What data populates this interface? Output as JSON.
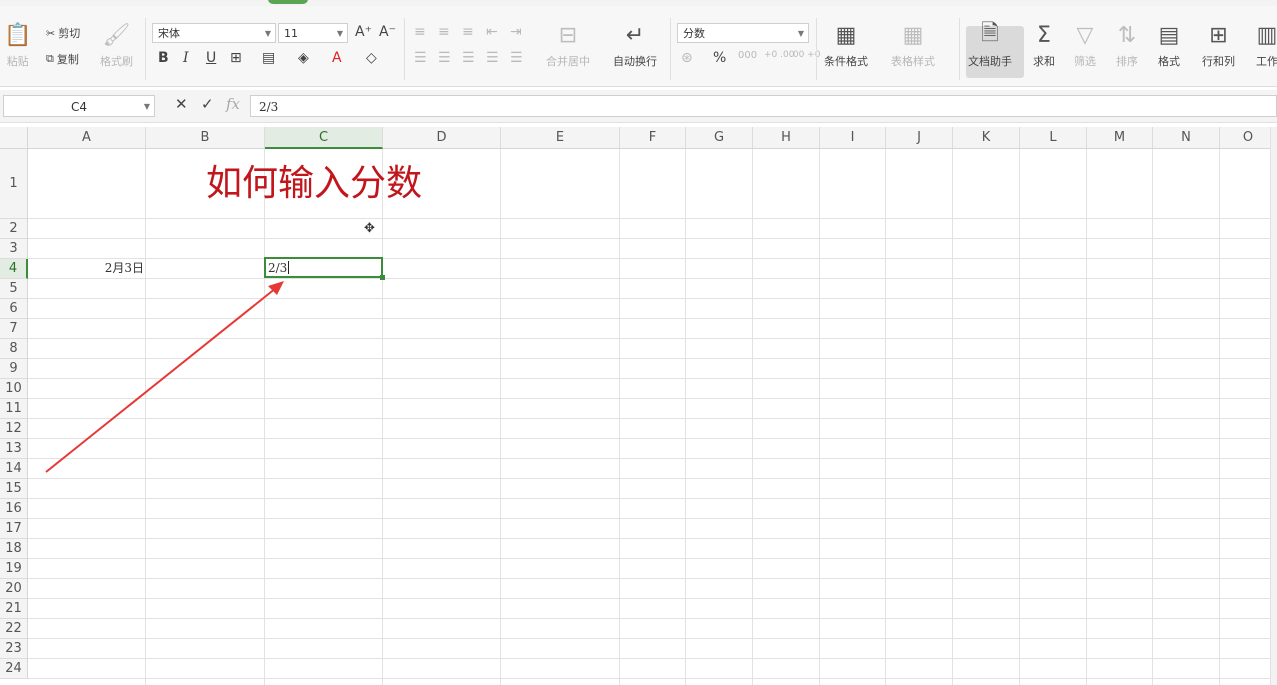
{
  "ribbon": {
    "paste": "粘贴",
    "cut": "剪切",
    "copy": "复制",
    "format_painter": "格式刷",
    "font_name": "宋体",
    "font_size": "11",
    "bold": "B",
    "italic": "I",
    "underline": "U",
    "merge_center": "合并居中",
    "wrap_text": "自动换行",
    "number_format": "分数",
    "percent": "%",
    "thousands": "000",
    "dec_increase": "+0 .00",
    "dec_decrease": ".00 +0",
    "conditional_format": "条件格式",
    "table_style": "表格样式",
    "doc_assistant": "文档助手",
    "sum": "求和",
    "filter": "筛选",
    "sort": "排序",
    "format": "格式",
    "row_col": "行和列",
    "worksheet": "工作"
  },
  "formula_bar": {
    "name_box": "C4",
    "fx": "fx",
    "value": "2/3"
  },
  "columns": [
    "A",
    "B",
    "C",
    "D",
    "E",
    "F",
    "G",
    "H",
    "I",
    "J",
    "K",
    "L",
    "M",
    "N",
    "O"
  ],
  "rows": [
    "1",
    "2",
    "3",
    "4",
    "5",
    "6",
    "7",
    "8",
    "9",
    "10",
    "11",
    "12",
    "13",
    "14",
    "15",
    "16",
    "17",
    "18",
    "19",
    "20",
    "21",
    "22",
    "23",
    "24"
  ],
  "cells": {
    "title": "如何输入分数",
    "a4": "2月3日",
    "c4": "2/3"
  },
  "selection": {
    "column": "C",
    "row": "4"
  },
  "colors": {
    "title_red": "#c0161c",
    "select_green": "#3b8d3b",
    "arrow_red": "#e53935"
  }
}
